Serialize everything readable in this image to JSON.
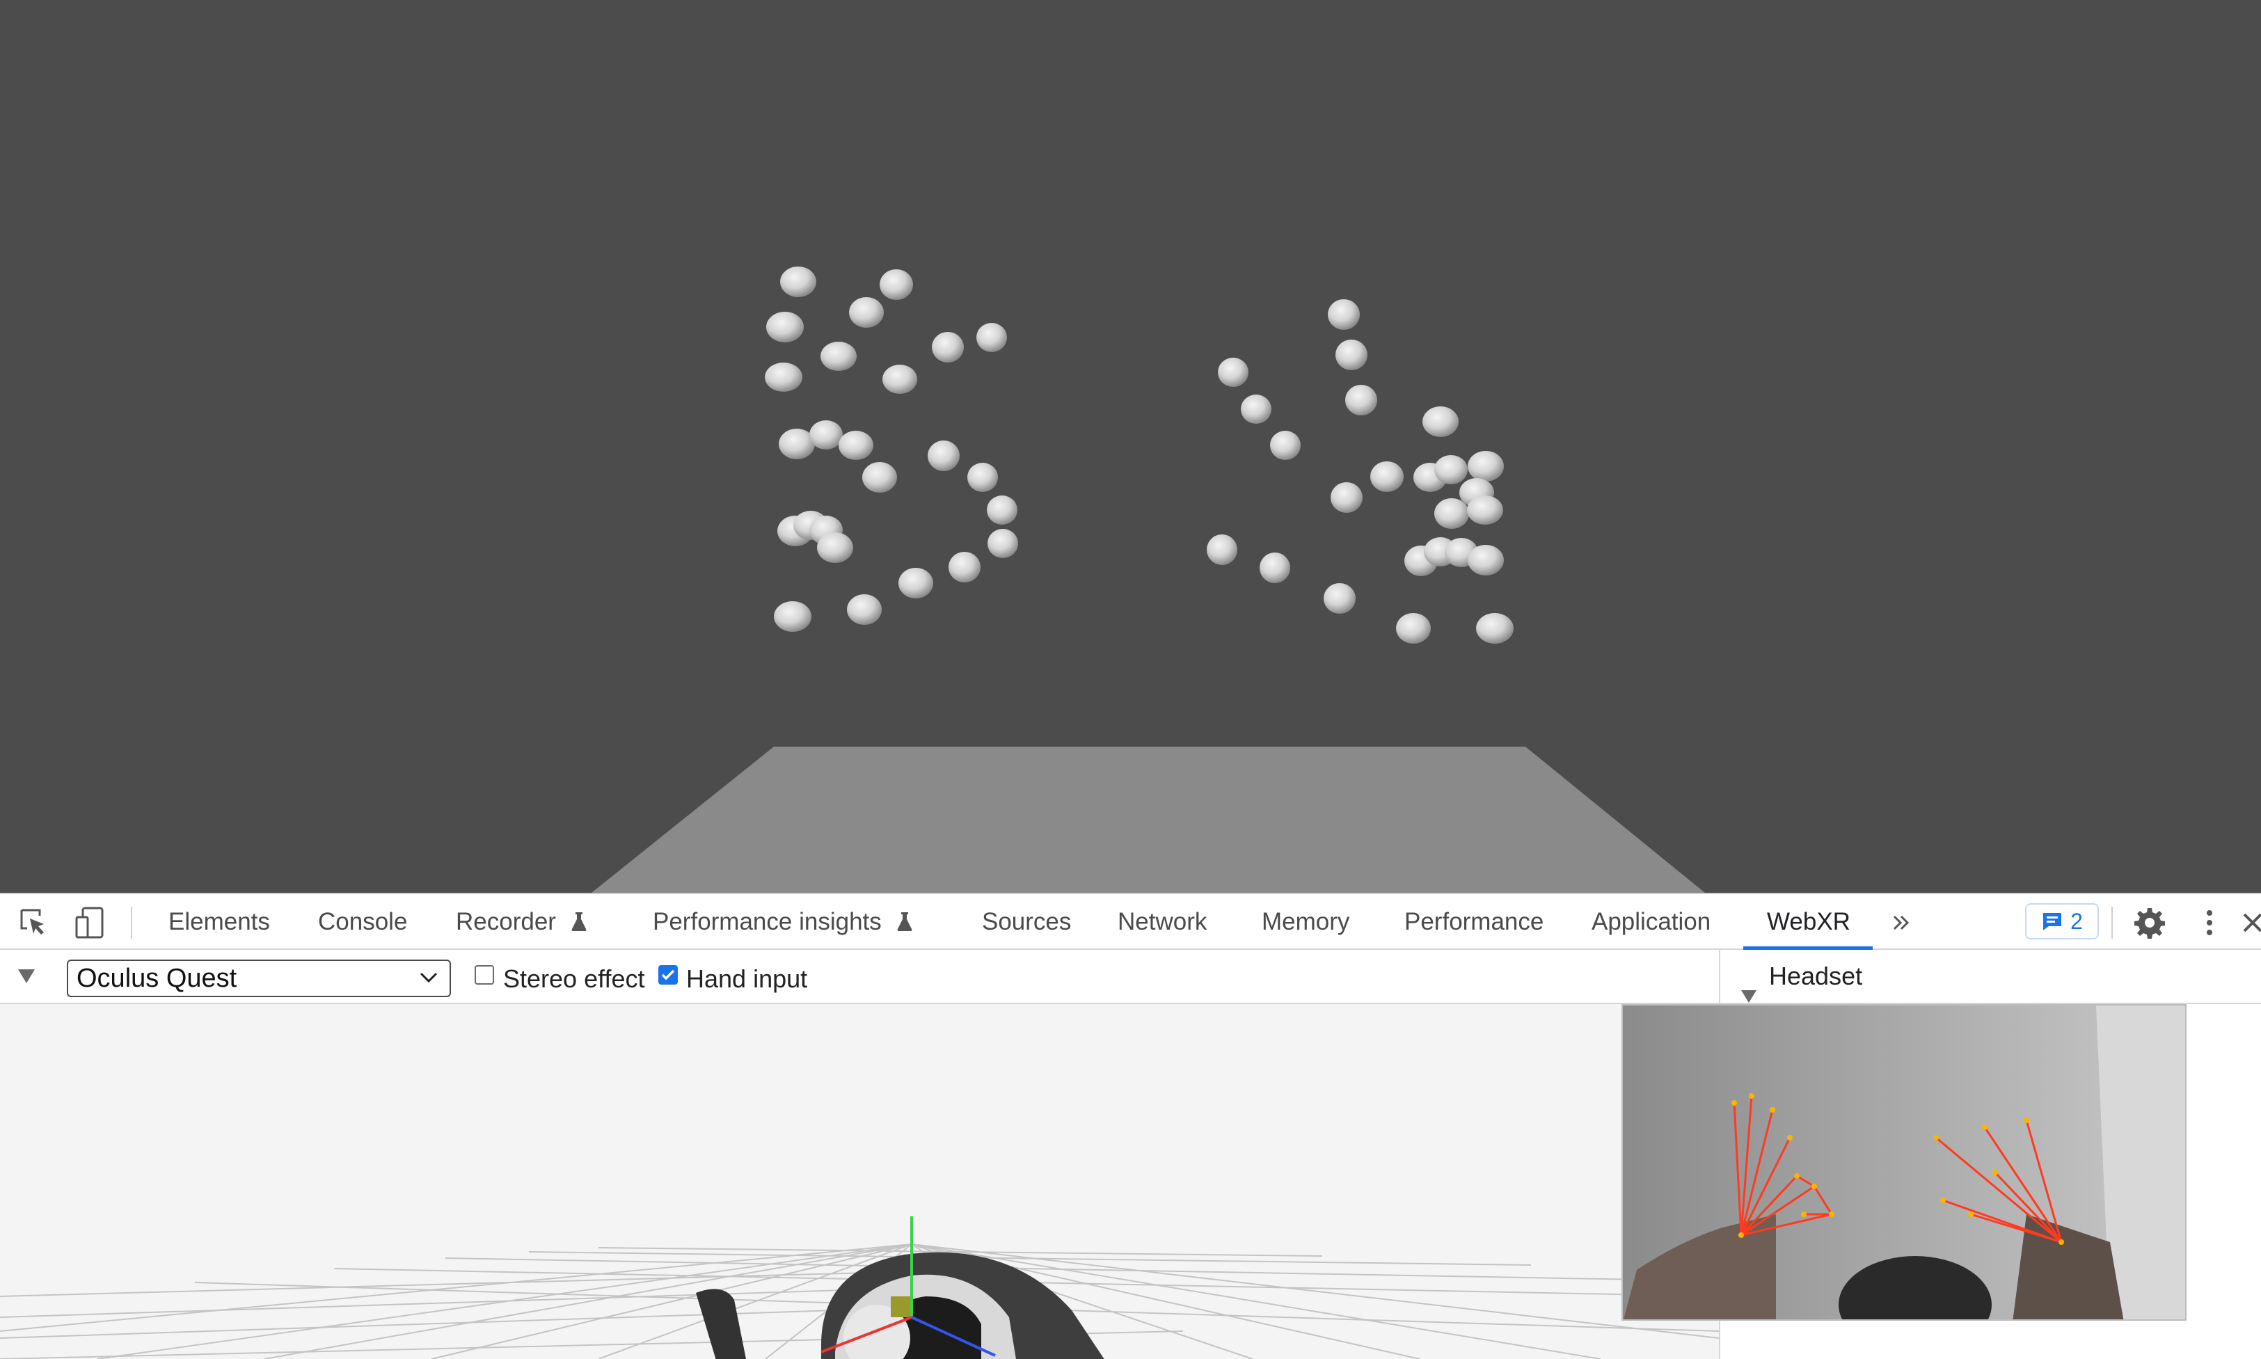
{
  "devtools": {
    "tabs": [
      {
        "label": "Elements",
        "active": false
      },
      {
        "label": "Console",
        "active": false
      },
      {
        "label": "Recorder",
        "active": false,
        "experimental": true
      },
      {
        "label": "Performance insights",
        "active": false,
        "experimental": true
      },
      {
        "label": "Sources",
        "active": false
      },
      {
        "label": "Network",
        "active": false
      },
      {
        "label": "Memory",
        "active": false
      },
      {
        "label": "Performance",
        "active": false
      },
      {
        "label": "Application",
        "active": false
      },
      {
        "label": "WebXR",
        "active": true
      }
    ],
    "more_tabs_icon": "chevron-double-right-icon",
    "issues_count": "2",
    "icons": {
      "inspect": "inspect-element-icon",
      "device": "device-toolbar-icon",
      "issues": "issues-chat-icon",
      "settings": "gear-icon",
      "menu": "kebab-menu-icon",
      "close": "close-icon"
    },
    "accent_color": "#1a73e8"
  },
  "webxr": {
    "device_select": {
      "value": "Oculus Quest"
    },
    "stereo_effect": {
      "label": "Stereo effect",
      "checked": false
    },
    "hand_input": {
      "label": "Hand input",
      "checked": true
    },
    "panel": {
      "title": "Headset"
    }
  }
}
